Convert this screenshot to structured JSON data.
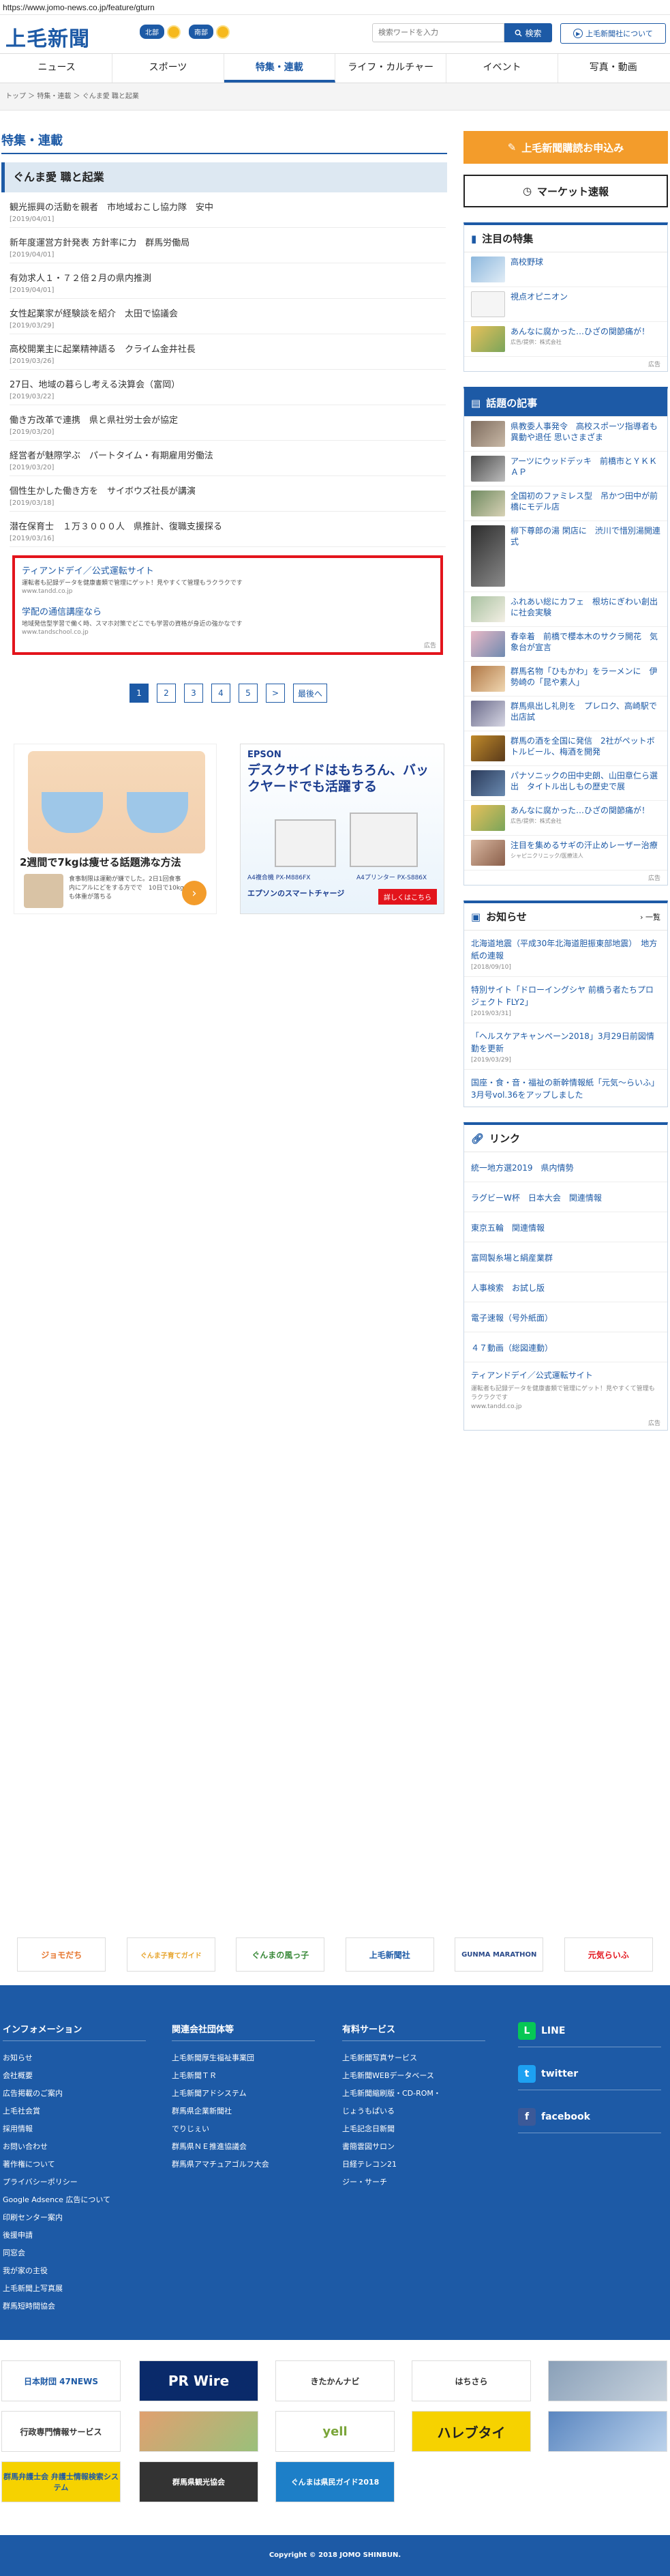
{
  "url": "https://www.jomo-news.co.jp/feature/gturn",
  "header": {
    "logo": "上毛新聞",
    "weather": [
      {
        "region": "北部"
      },
      {
        "region": "南部"
      }
    ],
    "search_placeholder": "検索ワードを入力",
    "search_button": "検索",
    "about_button": "上毛新聞社について"
  },
  "nav": [
    {
      "label": "ニュース"
    },
    {
      "label": "スポーツ"
    },
    {
      "label": "特集・連載"
    },
    {
      "label": "ライフ・カルチャー"
    },
    {
      "label": "イベント"
    },
    {
      "label": "写真・動画"
    }
  ],
  "breadcrumb": "トップ ＞ 特集・連載 ＞ ぐんま愛 職と起業",
  "section_title": "特集・連載",
  "category_title": "ぐんま愛 職と起業",
  "articles": [
    {
      "title": "観光振興の活動を親者　市地域おこし協力隊　安中",
      "date": "[2019/04/01]"
    },
    {
      "title": "新年度運営方針発表 方針率に力　群馬労働局",
      "date": "[2019/04/01]"
    },
    {
      "title": "有効求人１・７２倍２月の県内推測",
      "date": "[2019/04/01]"
    },
    {
      "title": "女性起業家が経験談を紹介　太田で協議会",
      "date": "[2019/03/29]"
    },
    {
      "title": "高校開業主に起業精神語る　クライム金井社長",
      "date": "[2019/03/26]"
    },
    {
      "title": "27日、地域の暮らし考える決算会（富岡）",
      "date": "[2019/03/22]"
    },
    {
      "title": "働き方改革で連携　県と県社労士会が協定",
      "date": "[2019/03/20]"
    },
    {
      "title": "経営者が魅際学ぶ　パートタイム・有期雇用労働法",
      "date": "[2019/03/20]"
    },
    {
      "title": "個性生かした働き方を　サイボウズ社長が講演",
      "date": "[2019/03/18]"
    },
    {
      "title": "潜在保育士　１万３０００人　県推計、復職支援探る",
      "date": "[2019/03/16]"
    }
  ],
  "ad_box": {
    "title1": "ティアンドデイ／公式運転サイト",
    "desc1": "運転者も記録データを健康書類で管理にゲット！見やすくて管理もラクラクです",
    "url1": "www.tandd.co.jp",
    "title2": "学配の通信講座なら",
    "desc2": "地域発信型学習で働く時、スマホ対策でどこでも学習の資格が身近の強かなです",
    "url2": "www.tandschool.co.jp",
    "label": "広告"
  },
  "pager": [
    "1",
    "2",
    "3",
    "4",
    "5",
    ">",
    "最後へ"
  ],
  "ad_diet": {
    "headline": "2週間で7kgは痩せる話題沸な方法",
    "sub": "食事制限は運動が嫌でした。2日1回食事内にアルにどをする方でで　10日で10kgも体重が落ちる"
  },
  "ad_epson": {
    "brand": "EPSON",
    "copy": "デスクサイドはもちろん、バックヤードでも活躍する",
    "cap1": "A4複合機 PX-M886FX",
    "cap2": "A4プリンター PX-S886X",
    "foot": "エプソンのスマートチャージ",
    "button": "詳しくはこちら"
  },
  "sidebar": {
    "subscribe": "上毛新聞購読お申込み",
    "market": "マーケット速報",
    "featured": {
      "title": "注目の特集",
      "items": [
        {
          "title": "高校野球"
        },
        {
          "title": "視点オピニオン"
        },
        {
          "title": "あんなに腐かった…ひざの関節痛が！",
          "sponsor": "広告/提供：株式会社"
        }
      ],
      "ad_label": "広告"
    },
    "topics": {
      "title": "話題の記事",
      "items": [
        {
          "title": "県教委人事発令　高校スポーツ指導者も異動や退任 思いさまざま"
        },
        {
          "title": "アーツにウッドデッキ　前橋市とＹＫＫ　ＡＰ"
        },
        {
          "title": "全国初のファミレス型　吊かつ田中が前橋にモデル店"
        },
        {
          "title": "柳下尊郎の湯 閑店に　渋川で惜別湯開連式"
        },
        {
          "title": "ふれあい総にカフェ　根坊にぎわい創出に社会実験"
        },
        {
          "title": "春幸着　前橋で櫻本木のサクラ開花　気象台が宣言"
        },
        {
          "title": "群馬名物「ひもかわ」をラーメンに　伊勢崎の「昆や素人」"
        },
        {
          "title": "群馬県出し礼則を　プレロク、高崎駅で出店試"
        },
        {
          "title": "群馬の酒を全国に発信　2社がペットボトルビール、梅酒を開発"
        },
        {
          "title": "パナソニックの田中史朗、山田章仁ら選出　タイトル出しもの歴史で展"
        },
        {
          "title": "あんなに腐かった…ひざの関節痛が！",
          "sponsor": "広告/提供：株式会社"
        },
        {
          "title": "注目を集めるサギの汗止めレーザー治療",
          "sponsor": "シャピニクリニック/医療法人"
        }
      ],
      "ad_label": "広告"
    },
    "notices": {
      "title": "お知らせ",
      "more": "一覧",
      "items": [
        {
          "title": "北海道地震（平成30年北海道胆振東部地震）　地方紙の連報",
          "date": "[2018/09/10]"
        },
        {
          "title": "特別サイト「ドローイングシヤ 前橋う者たちプロジェクト FLY2」",
          "date": "[2019/03/31]"
        },
        {
          "title": "「ヘルスケアキャンペーン2018」3月29日前図情勤を更新",
          "date": "[2019/03/29]"
        },
        {
          "title": "国座・食・音・福祉の新幹情報紙「元気～らいふ」3月号vol.36をアップしました",
          "date": ""
        }
      ]
    },
    "links": {
      "title": "リンク",
      "items": [
        {
          "label": "統一地方選2019　県内情勢"
        },
        {
          "label": "ラグビーW杯　日本大会　関連情報"
        },
        {
          "label": "東京五輪　関連情報"
        },
        {
          "label": "富岡製糸場と絹産業群"
        },
        {
          "label": "人事検索　お試し版"
        },
        {
          "label": "電子速報（号外紙面）"
        },
        {
          "label": "４７動画（総図連動）"
        }
      ],
      "ad_title": "ティアンドデイ／公式運転サイト",
      "ad_desc": "運転者も記録データを健康書類で管理にゲット！見やすくて管理もラクラクです",
      "ad_url": "www.tandd.co.jp",
      "ad_label": "広告"
    }
  },
  "banners": [
    "ジョモだち",
    "ぐんま子育てガイド",
    "ぐんまの風っ子",
    "上毛新聞社",
    "GUNMA MARATHON",
    "元気らいふ"
  ],
  "footer": {
    "col1": {
      "title": "インフォメーション",
      "items": [
        "お知らせ",
        "会社概要",
        "広告掲載のご案内",
        "上毛社会賞",
        "採用情報",
        "お問い合わせ",
        "著作権について",
        "プライバシーポリシー",
        "Google Adsence 広告について",
        "印刷センター案内",
        "後援申請",
        "同窓会",
        "我が家の主役",
        "上毛新聞上写真展",
        "群馬短時間協会"
      ]
    },
    "col2": {
      "title": "関連会社団体等",
      "items": [
        "上毛新聞厚生福祉事業団",
        "上毛新聞ＴＲ",
        "上毛新聞アドシステム",
        "群馬県企業新聞社",
        "でりじぇい",
        "群馬県ＮＥ推進協議会",
        "群馬県アマチュアゴルフ大会"
      ]
    },
    "col3": {
      "title": "有料サービス",
      "items": [
        "上毛新聞写真サービス",
        "上毛新聞WEBデータベース",
        "上毛新聞縮刷版・CD-ROM・",
        "じょうもぱいる",
        "上毛記念日新聞",
        "書簡雲図サロン",
        "日経テレコン21",
        "ジー・サーチ"
      ]
    },
    "social": [
      {
        "label": "LINE"
      },
      {
        "label": "twitter"
      },
      {
        "label": "facebook"
      }
    ]
  },
  "banners2": [
    "日本財団 47NEWS",
    "PR Wire",
    "きたかんナビ",
    "はちさら",
    "",
    "行政専門情報サービス",
    "",
    "yell",
    "ハレブタイ",
    "",
    "群馬弁護士会 弁護士情報検索システム",
    "群馬県観光協会",
    "ぐんまは県民ガイド2018"
  ],
  "copyright": "Copyright © 2018 JOMO SHINBUN."
}
